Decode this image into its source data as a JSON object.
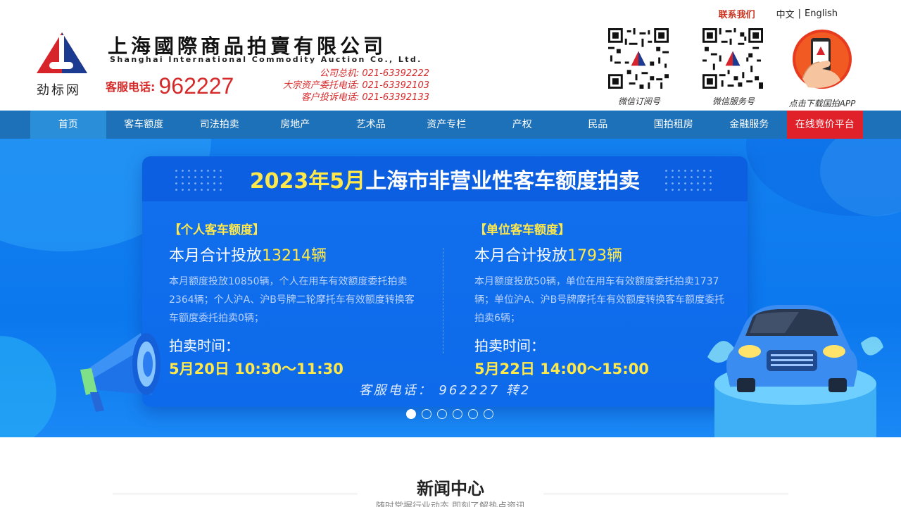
{
  "header": {
    "contact_link": "联系我们",
    "lang_cn": "中文",
    "lang_sep": "|",
    "lang_en": "English",
    "logo_text": "劲标网",
    "company_name_cn": "上海國際商品拍賣有限公司",
    "company_name_en": "Shanghai International Commodity Auction Co., Ltd.",
    "service_label": "客服电话:",
    "service_number": "962227",
    "phone_lines": [
      "公司总机: 021-63392222",
      "大宗资产委托电话: 021-63392103",
      "客户投诉电话: 021-63392133"
    ],
    "qr_codes": [
      {
        "caption": "微信订阅号",
        "icon": "qr-code-icon"
      },
      {
        "caption": "微信服务号",
        "icon": "qr-code-icon"
      }
    ],
    "app_caption": "点击下载国拍APP"
  },
  "nav": {
    "items": [
      {
        "label": "首页",
        "active": true
      },
      {
        "label": "客车额度"
      },
      {
        "label": "司法拍卖"
      },
      {
        "label": "房地产"
      },
      {
        "label": "艺术品"
      },
      {
        "label": "资产专栏"
      },
      {
        "label": "产权"
      },
      {
        "label": "民品"
      },
      {
        "label": "国拍租房"
      },
      {
        "label": "金融服务"
      },
      {
        "label": "在线竞价平台",
        "highlight": true
      }
    ]
  },
  "banner": {
    "title_highlight": "2023年5月",
    "title_rest": "上海市非营业性客车额度拍卖",
    "personal": {
      "tag": "【个人客车额度】",
      "total_prefix": "本月合计投放",
      "total_value": "13214辆",
      "desc": "本月额度投放10850辆，个人在用车有效额度委托拍卖2364辆；个人沪A、沪B号牌二轮摩托车有效额度转换客车额度委托拍卖0辆；",
      "time_label": "拍卖时间：",
      "time_value": "5月20日 10:30～11:30"
    },
    "company": {
      "tag": "【单位客车额度】",
      "total_prefix": "本月合计投放",
      "total_value": "1793辆",
      "desc": "本月额度投放50辆，单位在用车有效额度委托拍卖1737辆；单位沪A、沪B号牌摩托车有效额度转换客车额度委托拍卖6辆；",
      "time_label": "拍卖时间：",
      "time_value": "5月22日 14:00～15:00"
    },
    "footer": "客服电话： 962227 转2",
    "slides": 6,
    "current_slide": 1
  },
  "news": {
    "title": "新闻中心",
    "subtitle": "随时掌握行业动态 即刻了解热点资讯"
  },
  "colors": {
    "nav_bg": "#1d71b8",
    "nav_active": "#2a8ed8",
    "nav_highlight": "#e0212a",
    "brand_red": "#d62a2a",
    "banner_yellow": "#ffe94a"
  }
}
